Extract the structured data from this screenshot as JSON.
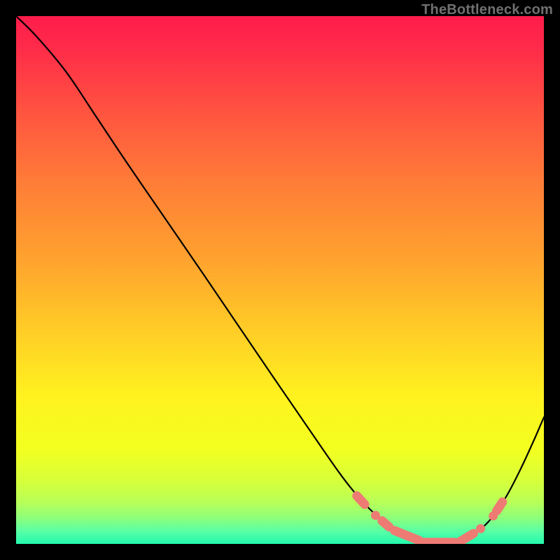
{
  "watermark": "TheBottleneck.com",
  "chart_data": {
    "type": "line",
    "title": "",
    "xlabel": "",
    "ylabel": "",
    "xlim": [
      0,
      100
    ],
    "ylim": [
      0,
      100
    ],
    "gradient_stops": [
      {
        "t": 0.0,
        "color": "#ff1c4b"
      },
      {
        "t": 0.06,
        "color": "#ff2b49"
      },
      {
        "t": 0.18,
        "color": "#ff5340"
      },
      {
        "t": 0.32,
        "color": "#ff7e37"
      },
      {
        "t": 0.46,
        "color": "#ffa22e"
      },
      {
        "t": 0.6,
        "color": "#ffce26"
      },
      {
        "t": 0.72,
        "color": "#fff21f"
      },
      {
        "t": 0.82,
        "color": "#f3ff1f"
      },
      {
        "t": 0.88,
        "color": "#d7ff3a"
      },
      {
        "t": 0.92,
        "color": "#b9ff57"
      },
      {
        "t": 0.95,
        "color": "#8fff7a"
      },
      {
        "t": 0.975,
        "color": "#5bffa4"
      },
      {
        "t": 1.0,
        "color": "#22f9ae"
      }
    ],
    "curve": {
      "comment": "y is normalized 0..1 from top; x is normalized 0..1 from left, over the inner plot square",
      "points": [
        {
          "x": 0.0,
          "y": 0.0
        },
        {
          "x": 0.04,
          "y": 0.04
        },
        {
          "x": 0.095,
          "y": 0.106
        },
        {
          "x": 0.15,
          "y": 0.188
        },
        {
          "x": 0.21,
          "y": 0.278
        },
        {
          "x": 0.28,
          "y": 0.38
        },
        {
          "x": 0.35,
          "y": 0.482
        },
        {
          "x": 0.42,
          "y": 0.585
        },
        {
          "x": 0.49,
          "y": 0.688
        },
        {
          "x": 0.56,
          "y": 0.79
        },
        {
          "x": 0.61,
          "y": 0.862
        },
        {
          "x": 0.64,
          "y": 0.901
        },
        {
          "x": 0.67,
          "y": 0.934
        },
        {
          "x": 0.7,
          "y": 0.96
        },
        {
          "x": 0.73,
          "y": 0.979
        },
        {
          "x": 0.76,
          "y": 0.991
        },
        {
          "x": 0.79,
          "y": 0.997
        },
        {
          "x": 0.82,
          "y": 0.997
        },
        {
          "x": 0.85,
          "y": 0.99
        },
        {
          "x": 0.88,
          "y": 0.972
        },
        {
          "x": 0.905,
          "y": 0.946
        },
        {
          "x": 0.93,
          "y": 0.908
        },
        {
          "x": 0.955,
          "y": 0.86
        },
        {
          "x": 0.98,
          "y": 0.806
        },
        {
          "x": 1.0,
          "y": 0.76
        }
      ]
    },
    "markers": [
      {
        "x": 0.653,
        "y": 0.917,
        "kind": "pill",
        "len": 0.022
      },
      {
        "x": 0.681,
        "y": 0.946,
        "kind": "dot"
      },
      {
        "x": 0.7,
        "y": 0.962,
        "kind": "pill",
        "len": 0.018
      },
      {
        "x": 0.74,
        "y": 0.984,
        "kind": "pill",
        "len": 0.05
      },
      {
        "x": 0.8,
        "y": 0.997,
        "kind": "pill",
        "len": 0.06
      },
      {
        "x": 0.852,
        "y": 0.989,
        "kind": "pill",
        "len": 0.034
      },
      {
        "x": 0.88,
        "y": 0.971,
        "kind": "dot"
      },
      {
        "x": 0.904,
        "y": 0.947,
        "kind": "dot"
      },
      {
        "x": 0.916,
        "y": 0.929,
        "kind": "pill",
        "len": 0.02
      }
    ],
    "marker_color": "#ed7b74",
    "curve_color": "#000000"
  }
}
